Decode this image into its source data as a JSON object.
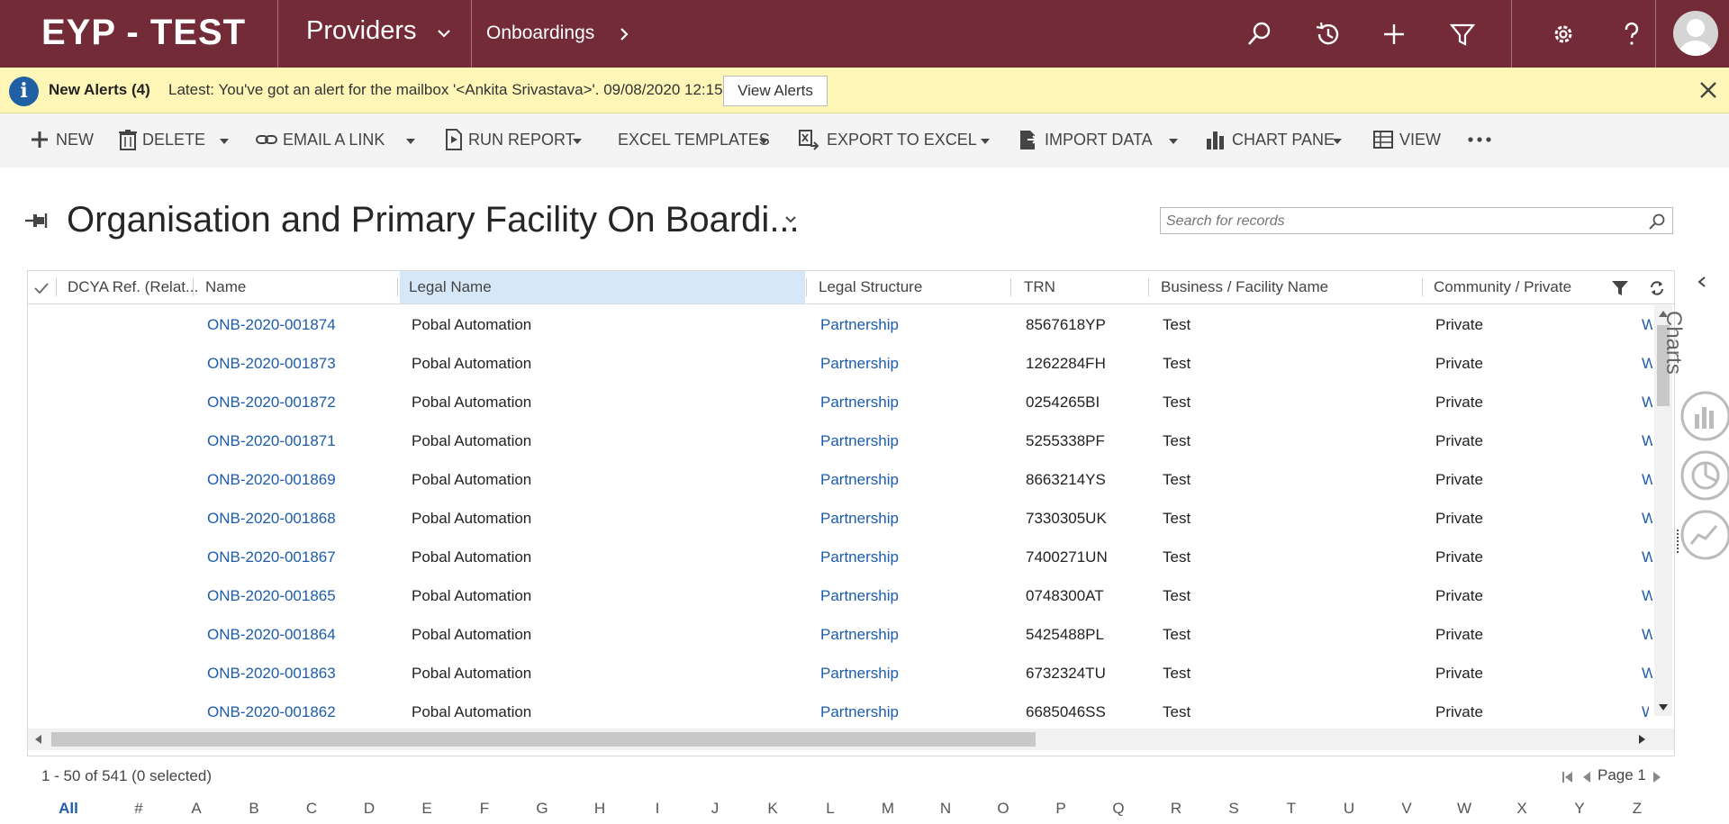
{
  "topbar": {
    "brand": "EYP - TEST",
    "area": "Providers",
    "breadcrumb": "Onboardings"
  },
  "alert": {
    "title": "New Alerts (4)",
    "message": "Latest: You've got an alert for the mailbox '<Ankita Srivastava>'. 09/08/2020 12:15",
    "button": "View Alerts"
  },
  "commands": {
    "new": "NEW",
    "delete": "DELETE",
    "email_link": "EMAIL A LINK",
    "run_report": "RUN REPORT",
    "excel_templates": "EXCEL TEMPLATES",
    "export_excel": "EXPORT TO EXCEL",
    "import_data": "IMPORT DATA",
    "chart_pane": "CHART PANE",
    "view": "VIEW"
  },
  "view": {
    "title": "Organisation and Primary Facility On Boardi..."
  },
  "search": {
    "placeholder": "Search for records"
  },
  "grid": {
    "columns": [
      "DCYA Ref. (Relat...",
      "Name",
      "Legal Name",
      "Legal Structure",
      "TRN",
      "Business / Facility Name",
      "Community / Private"
    ],
    "rows": [
      {
        "name": "ONB-2020-001874",
        "legal_name": "Pobal Automation",
        "structure": "Partnership",
        "trn": "8567618YP",
        "business": "Test",
        "community": "Private",
        "extra": "W"
      },
      {
        "name": "ONB-2020-001873",
        "legal_name": "Pobal Automation",
        "structure": "Partnership",
        "trn": "1262284FH",
        "business": "Test",
        "community": "Private",
        "extra": "W"
      },
      {
        "name": "ONB-2020-001872",
        "legal_name": "Pobal Automation",
        "structure": "Partnership",
        "trn": "0254265BI",
        "business": "Test",
        "community": "Private",
        "extra": "W"
      },
      {
        "name": "ONB-2020-001871",
        "legal_name": "Pobal Automation",
        "structure": "Partnership",
        "trn": "5255338PF",
        "business": "Test",
        "community": "Private",
        "extra": "W"
      },
      {
        "name": "ONB-2020-001869",
        "legal_name": "Pobal Automation",
        "structure": "Partnership",
        "trn": "8663214YS",
        "business": "Test",
        "community": "Private",
        "extra": "W"
      },
      {
        "name": "ONB-2020-001868",
        "legal_name": "Pobal Automation",
        "structure": "Partnership",
        "trn": "7330305UK",
        "business": "Test",
        "community": "Private",
        "extra": "W"
      },
      {
        "name": "ONB-2020-001867",
        "legal_name": "Pobal Automation",
        "structure": "Partnership",
        "trn": "7400271UN",
        "business": "Test",
        "community": "Private",
        "extra": "W"
      },
      {
        "name": "ONB-2020-001865",
        "legal_name": "Pobal Automation",
        "structure": "Partnership",
        "trn": "0748300AT",
        "business": "Test",
        "community": "Private",
        "extra": "W"
      },
      {
        "name": "ONB-2020-001864",
        "legal_name": "Pobal Automation",
        "structure": "Partnership",
        "trn": "5425488PL",
        "business": "Test",
        "community": "Private",
        "extra": "W"
      },
      {
        "name": "ONB-2020-001863",
        "legal_name": "Pobal Automation",
        "structure": "Partnership",
        "trn": "6732324TU",
        "business": "Test",
        "community": "Private",
        "extra": "W"
      },
      {
        "name": "ONB-2020-001862",
        "legal_name": "Pobal Automation",
        "structure": "Partnership",
        "trn": "6685046SS",
        "business": "Test",
        "community": "Private",
        "extra": "W"
      }
    ]
  },
  "footer": {
    "status": "1 - 50 of 541 (0 selected)",
    "page": "Page 1"
  },
  "jumpbar": [
    "All",
    "#",
    "A",
    "B",
    "C",
    "D",
    "E",
    "F",
    "G",
    "H",
    "I",
    "J",
    "K",
    "L",
    "M",
    "N",
    "O",
    "P",
    "Q",
    "R",
    "S",
    "T",
    "U",
    "V",
    "W",
    "X",
    "Y",
    "Z"
  ],
  "charts_pane": {
    "label": "Charts"
  },
  "colors": {
    "nav_bg": "#722b37",
    "alert_bg": "#fdf6b7",
    "link": "#1c5cab",
    "selected_header": "#d6e8f7"
  }
}
